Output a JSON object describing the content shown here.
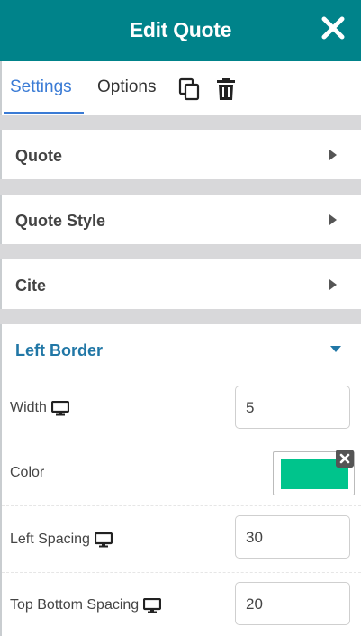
{
  "header": {
    "title": "Edit Quote",
    "close_icon": "close-icon"
  },
  "tabs": [
    {
      "label": "Settings",
      "active": true
    },
    {
      "label": "Options",
      "active": false
    }
  ],
  "toolbar_icons": [
    "copy-icon",
    "trash-icon"
  ],
  "panels": [
    {
      "label": "Quote",
      "state": "collapsed"
    },
    {
      "label": "Quote Style",
      "state": "collapsed"
    },
    {
      "label": "Cite",
      "state": "collapsed"
    },
    {
      "label": "Left Border",
      "state": "expanded"
    }
  ],
  "left_border": {
    "width": {
      "label": "Width",
      "value": "5",
      "icon": "desktop-icon"
    },
    "color": {
      "label": "Color",
      "value": "#00c48c"
    },
    "left_spacing": {
      "label": "Left Spacing",
      "value": "30",
      "icon": "desktop-icon"
    },
    "top_bottom_spacing": {
      "label": "Top Bottom Spacing",
      "value": "20",
      "icon": "desktop-icon"
    }
  },
  "colors": {
    "header_bg": "#00838a",
    "active_tab": "#3a7bd5",
    "expanded_label": "#2177a6",
    "swatch": "#00c48c"
  }
}
